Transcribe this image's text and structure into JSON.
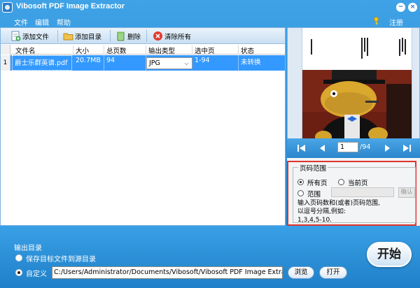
{
  "window": {
    "title": "Vibosoft PDF Image Extractor",
    "minimize_glyph": "−",
    "close_glyph": "×"
  },
  "menu": {
    "items": [
      "文件",
      "编辑",
      "帮助"
    ],
    "register": "注册"
  },
  "toolbar": {
    "add_file": "添加文件",
    "add_folder": "添加目录",
    "delete": "删除",
    "clear_all": "清除所有"
  },
  "table": {
    "columns": [
      "文件名",
      "大小",
      "总页数",
      "输出类型",
      "选中页",
      "状态"
    ],
    "rows": [
      {
        "index": "1",
        "file": "爵士乐群英谱.pdf",
        "size": "20.7MB",
        "pages": "94",
        "type": "JPG",
        "selected": "1-94",
        "status": "未转换"
      }
    ]
  },
  "preview": {
    "current_page": "1",
    "total_pages": "/94"
  },
  "page_range": {
    "title": "页码范围",
    "all_pages": "所有页",
    "current_page": "当前页",
    "range": "范围",
    "confirm": "确认",
    "hint_line1": "输入页码数和(或者)页码范围,",
    "hint_line2": "以逗号分隔,例如:",
    "hint_line3": "1,3,4,5-10.",
    "selected": "all_pages"
  },
  "output": {
    "title": "输出目录",
    "save_to_source": "保存目标文件到源目录",
    "custom": "自定义",
    "path": "C:/Users/Administrator/Documents/Vibosoft/Vibosoft PDF Image Extractor",
    "browse": "浏览",
    "open": "打开",
    "selected": "custom"
  },
  "start_button": "开始"
}
